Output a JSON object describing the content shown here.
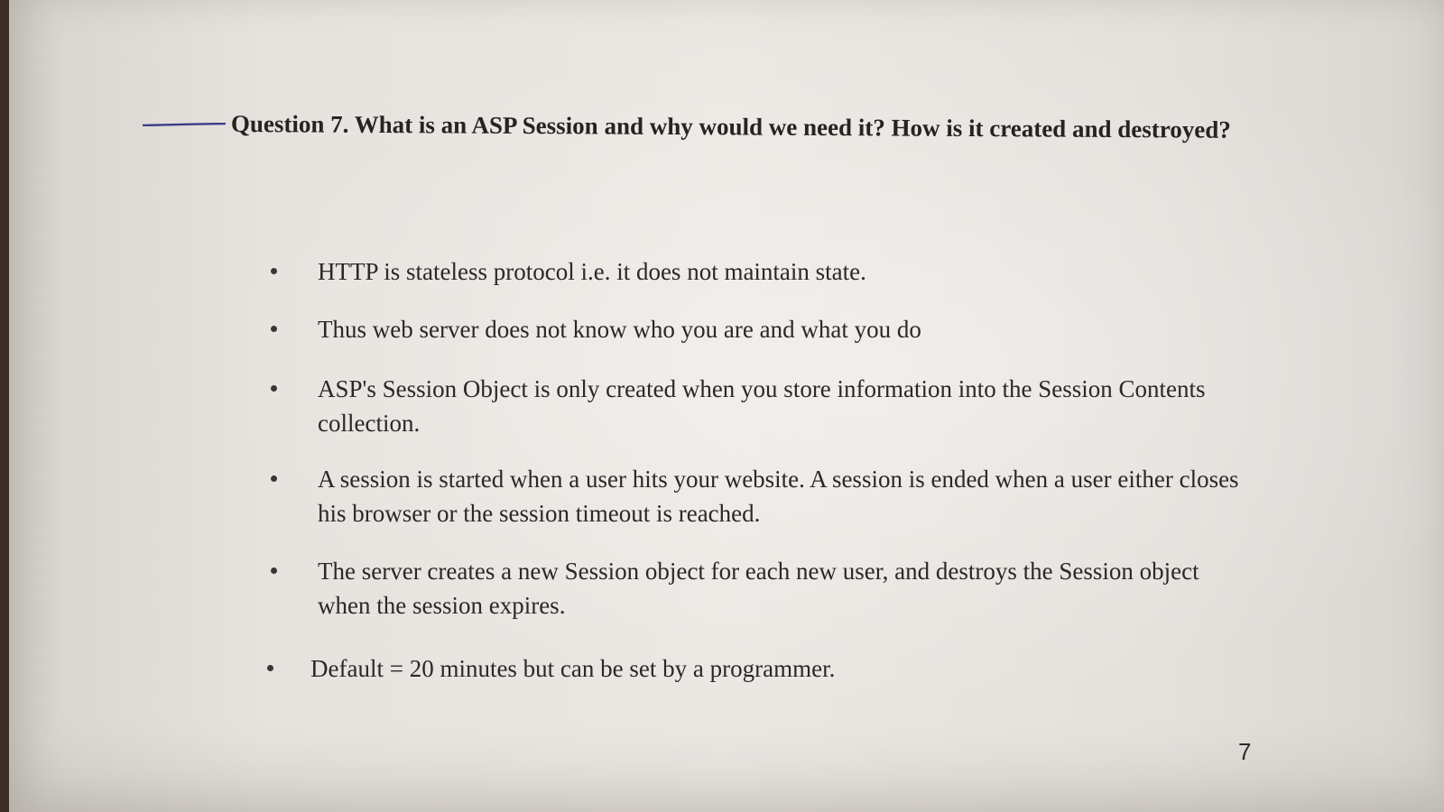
{
  "document": {
    "question": "Question 7. What is an ASP Session and why would we need it?  How is it created and destroyed?",
    "bullets": [
      "HTTP is stateless protocol i.e. it does not maintain state.",
      "Thus web server does not know who you are and what you do",
      "ASP's Session Object is only created when you store information into the Session Contents collection.",
      "A session is started when a user hits your website. A session is ended when a user either closes his browser or the session timeout is reached.",
      "The server creates a new Session object for each new user, and destroys the Session object when the session expires.",
      "Default = 20 minutes but can be set by a programmer."
    ],
    "page_number": "7"
  },
  "colors": {
    "paper": "#e8e5e0",
    "text": "#2b2826",
    "pen_ink": "#3b3f86"
  }
}
